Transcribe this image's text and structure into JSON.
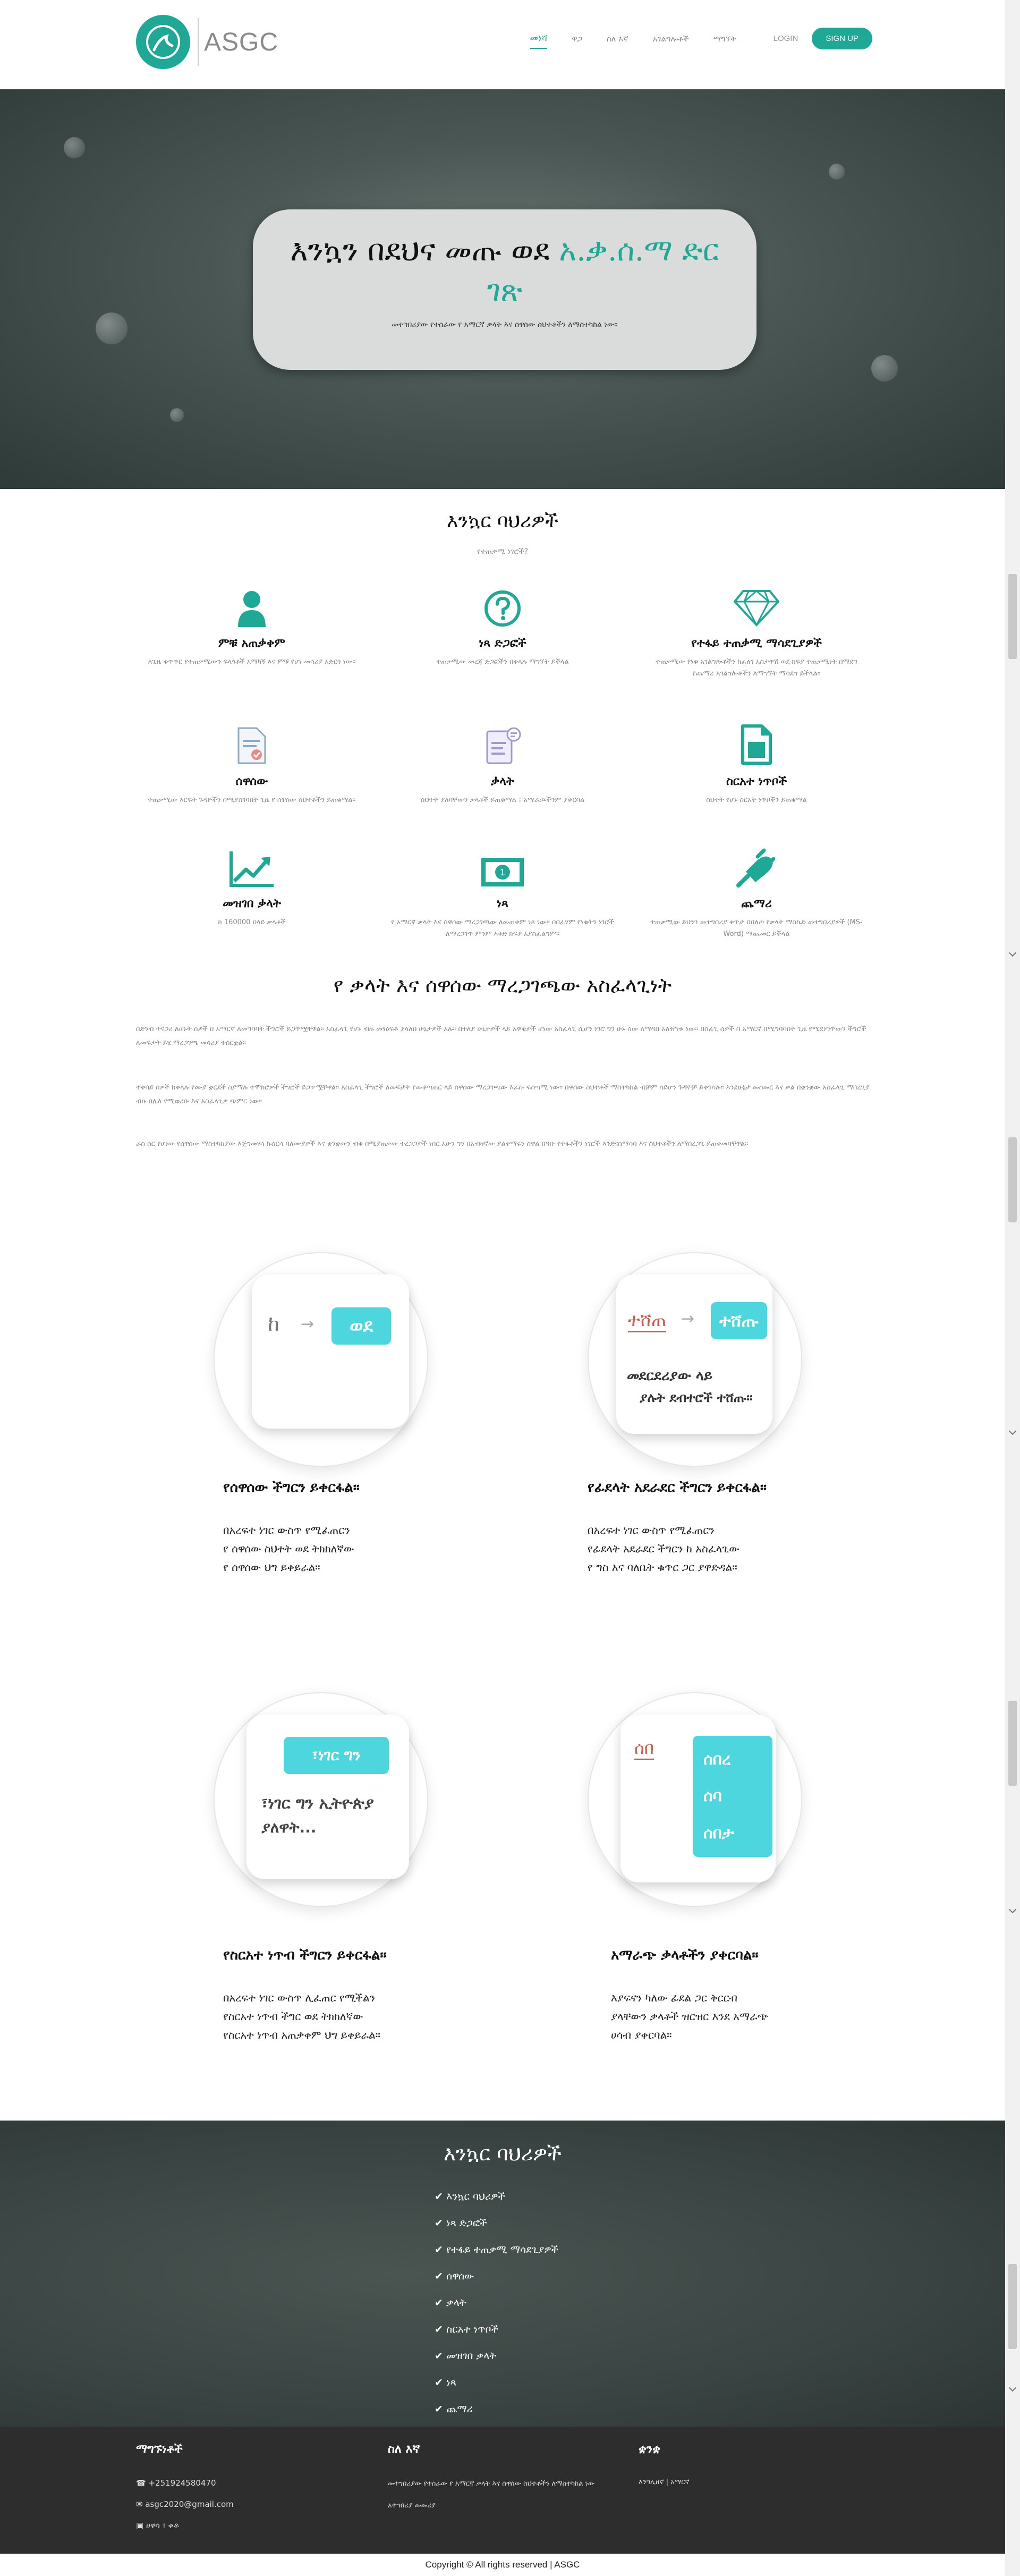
{
  "brand": {
    "name": "ASGC"
  },
  "nav": {
    "items": [
      "መነሻ",
      "ዋጋ",
      "ስለ እኛ",
      "አገልግሎቶች",
      "ማግኘት"
    ],
    "login": "LOGIN",
    "signup": "SIGN UP"
  },
  "hero": {
    "title_part1": "እንኳን በደህና መጡ ወደ",
    "title_accent": "አ.ቃ.ሰ.ማ ድር ገጽ",
    "subtitle": "መተግበሪያው የተሰራው የ አማርኛ ቃላት እና ሰዋሰው ስህተቶችን ለማስተካከል ነው።"
  },
  "features_section": {
    "title": "እንኳር ባህሪዎች",
    "subtitle": "የተጠቃሚ ነገሮች?",
    "items": [
      {
        "icon": "user-icon",
        "name": "ምቹ አጠቃቀም",
        "desc": "ለጊዜ ቁጥጥር የተጠቃሚውን ፍላጎቶች አማካኝ እና ምቹ የሆነ መሳሪያ አድርጎ ነው።"
      },
      {
        "icon": "question-circle-icon",
        "name": "ነጻ ድጋፎች",
        "desc": "ተጠቃሚው መረጃ ድጋፎችን በቀላሉ ማግኘት ይችላል"
      },
      {
        "icon": "diamond-icon",
        "name": "የተፋይ ተጠቃሚ ማሳደጊያዎች",
        "desc": "ተጠቃሚው የነቁ አገልግሎቶችን ከፈለገ አስታዋሽ ወደ ክፍያ ተጠቃሚነት በማደግ የጨማሪ አገልግሎቶችን ለማግኘት ማሳደግ ይችላል።"
      },
      {
        "icon": "document-check-icon",
        "name": "ሰዋሰው",
        "desc": "ተጠቃሚው እርፍት ጉዳዮችን በሚያስገባበት ጊዜ የ ሰዋሰው ስህተቶችን ይጠቁማል።"
      },
      {
        "icon": "document-comment-icon",
        "name": "ቃላት",
        "desc": "ስህተት ያለባቸውን ቃላቶች ይጠቁማል ፤ አማራጮችንም ያቀርባል"
      },
      {
        "icon": "file-icon",
        "name": "ስርአተ ነጥቦች",
        "desc": "ስህተት የሆኑ ስርአት ነጥቦችን ይጠቁማል"
      },
      {
        "icon": "chart-line-icon",
        "name": "መዝገበ ቃላት",
        "desc": "ከ 160000 በላይ ቃላቶች"
      },
      {
        "icon": "money-icon",
        "name": "ነጻ",
        "desc": "የ አማርኛ ቃላት እና ሰዋሰው ማረጋገጫው ለመጠቀም ነጻ ነው። በበፊሃም የነቁትን ነገሮች ለማረጋገጥ ምንም እቅድ ክፍያ አያስፈልግም።"
      },
      {
        "icon": "plug-icon",
        "name": "ጨማሪ",
        "desc": "ተጠቃሚው ይህንን መተግበሪያ ቀጥታ በበለጦ የቃላት ማስኬድ መተግበሪያዎች (MS-Word) ማጨመር ይችላል"
      }
    ]
  },
  "assurance": {
    "title": "የ ቃላት እና ሰዋሰው ማረጋገጫው አስፈላጊነት",
    "paragraphs": [
      "በድንብ ተናጋሪ ለሆኑት ሰዎች በ አማርኛ ለመግባባት ችግሮች ይጋጥሟቸዋል። አስፈላጊ የሆኑ ብዙ መፃዕፍቶ ያላለበ ሁኔታዎች አሉ። በተለያ ሁኔታዎች ላይ አዋቂዎች ሆነው አስፈላጊ ሲሆን ነገሮ ግን ሁኑ ሰው ለማዳበ አለዥነቱ ነው። በስፊጊ ሰዎች በ አማርኛ በሚግባባበት ጊዜ የሚደነግጥውን ችግሮች ለመፍታት ይሄ ማረጋገጫ መሳሪያ ተሰርቷል።",
      "ተቀባይ ሰዎች ከቀላሉ የሙያ ቋርደች ስያማሉ ተሞክሮዎች ችግሮች ይጋጥሟቸዋል። አስፈላጊ ችግሮች ለመፍታት የመቆጣጠር ላይ ሰዋሰው ማረጋገጫው እራሱ ፍሰጣሚ ነው። በዋሰው ስህተቶች ማስተካከል ብቻም ሳይሆን ጉዳዮቻ ይቀንሳሉ። እንደሁኔታ መሰመር እና ቃል በቋንቋው አስፈላጊ ማበረጊያ ብዙ በሌለ የሚወረቡ እና አስፈላጊዎ ጭምር ነው።",
      "ራስ ሰር የሆነው የሰዋሰው ማስተካከያው እጅግመሃሳ ኩሰርሳ ባለሙያዎች እና ቋንቋውን ብቁ በሚያጠቃው ተረጋጋዎች ነበር አሁን ግን በአብዛኛው ያልተማሩን ስዋል በዓቡ የተፋቶችን ነገሮች እንድናሰማሳባ እና ስህተቶችን ለማበረጋጊ ይጠቀመባቸዋል።"
    ]
  },
  "illustrations": [
    {
      "title": "የሰዋሰው ችግርን ይቀርፋል።",
      "lines": [
        "በአረፍተ ነገር ውስጥ የሚፈጠርን",
        "የ ሰዋሰው ስህተት ወደ ትክክለኛው",
        "የ ሰዋሰው ህግ ይቀይራል።"
      ],
      "from": "ከ",
      "to": "ወደ"
    },
    {
      "title": "የፊደላት አደራደር ችግርን ይቀርፋል።",
      "lines": [
        "በአረፍተ ነገር ውስጥ የሚፈጠርን",
        "የፊደላት አደራደር ችግርን ከ አስፈላጊው",
        "የ ግስ እና ባለቤት ቁጥር ጋር ያዋድዳል።"
      ],
      "from": "ተሸጠ",
      "to": "ተሸጡ",
      "card_line1": "መደርደሪያው ላይ",
      "card_line2": "ያሉት ደብተሮች ተሸጡ።"
    },
    {
      "title": "የስርአተ ነጥብ ችግርን ይቀርፋል።",
      "lines": [
        "በአረፍተ ነገር ውስጥ ሊፈጠር የሚችልን",
        "የስርአተ ነጥብ ችግር ወደ ትክክለኛው",
        "የስርአተ ነጥብ አጠቃቀም ህግ ይቀይራል።"
      ],
      "tag": "፣ነገር ግን",
      "card_line1": "፣ነገር ግን ኢትዮጵያ",
      "card_line2": "ያለዋት..."
    },
    {
      "title": "አማራጭ ቃላቶችን ያቀርባል።",
      "lines": [
        "እያፍናን ካለው ፊደል ጋር ቅርርብ",
        "ያላቸውን ቃላቶች ዝርዝር እንደ አማራጭ",
        "ሀሳብ ያቀርባል።"
      ],
      "word": "ሰበ",
      "options": [
        "ሰበረ",
        "ሰባ",
        "ሰበታ"
      ]
    }
  ],
  "banner": {
    "title": "እንኳር ባህሪዎች",
    "items": [
      "እንኳር ባህሪዎች",
      "ነጻ ድጋፎች",
      "የተፋይ ተጠቃሚ ማሳደጊያዎች",
      "ሰዋሰው",
      "ቃላት",
      "ስርአተ ነጥቦች",
      "መዝገበ ቃላት",
      "ነጻ",
      "ጨማሪ"
    ]
  },
  "footer": {
    "contact_title": "ማግኙነቶች",
    "phone": "+251924580470",
    "email": "asgc2020@gmail.com",
    "address": "ሀዋሳ ፣ ቀቶ",
    "about_title": "ስለ እኛ",
    "about_text": "መተግበሪያው የተሰራው የ አማርኛ ቃላት እና ሰዋሰው ስህተቶችን ለማስተካከል ነው",
    "about_link": "አተግበሪያ መመሪያ",
    "lang_title": "ቋንቋ",
    "lang_text": "እንግሊዘኛ | አማርኛ",
    "copyright": "Copyright © All rights reserved | ASGC"
  }
}
